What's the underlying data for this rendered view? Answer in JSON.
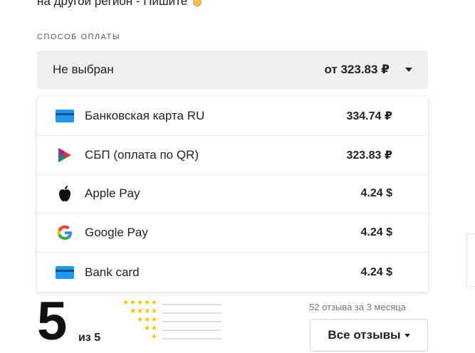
{
  "intro": {
    "text": "на другой регион - Пишите"
  },
  "payment": {
    "section_label": "СПОСОБ ОПЛАТЫ",
    "selected_value": "Не выбран",
    "selected_price": "от 323.83 ₽",
    "options": [
      {
        "name": "Банковская карта RU",
        "price": "334.74 ₽",
        "icon": "credit-card-icon"
      },
      {
        "name": "СБП (оплата по QR)",
        "price": "323.83 ₽",
        "icon": "sbp-icon"
      },
      {
        "name": "Apple Pay",
        "price": "4.24 $",
        "icon": "apple-icon"
      },
      {
        "name": "Google Pay",
        "price": "4.24 $",
        "icon": "google-icon"
      },
      {
        "name": "Bank card",
        "price": "4.24 $",
        "icon": "credit-card-icon"
      }
    ]
  },
  "rating": {
    "score": "5",
    "of_label": "из 5",
    "distribution": [
      {
        "stars": 5,
        "fraction": 1.0
      },
      {
        "stars": 4,
        "fraction": 0.0
      },
      {
        "stars": 3,
        "fraction": 0.0
      },
      {
        "stars": 2,
        "fraction": 0.0
      },
      {
        "stars": 1,
        "fraction": 0.0
      }
    ]
  },
  "reviews": {
    "count_label": "52 отзыва за 3 месяца",
    "all_reviews_label": "Все отзывы"
  },
  "colors": {
    "accent_blue": "#2196f3",
    "star_yellow": "#f2c200",
    "select_bg": "#f0f0f0"
  }
}
